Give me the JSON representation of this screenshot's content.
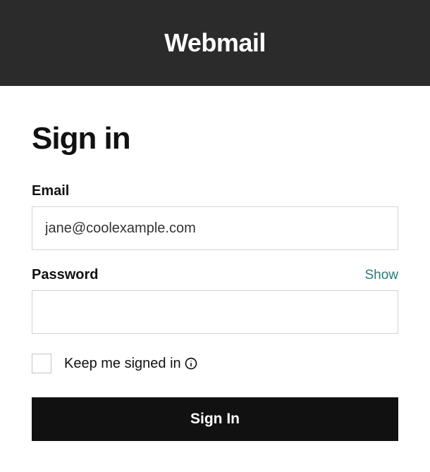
{
  "header": {
    "title": "Webmail"
  },
  "form": {
    "title": "Sign in",
    "email": {
      "label": "Email",
      "value": "jane@coolexample.com"
    },
    "password": {
      "label": "Password",
      "value": "",
      "show_label": "Show"
    },
    "remember": {
      "label": "Keep me signed in"
    },
    "submit_label": "Sign In"
  }
}
